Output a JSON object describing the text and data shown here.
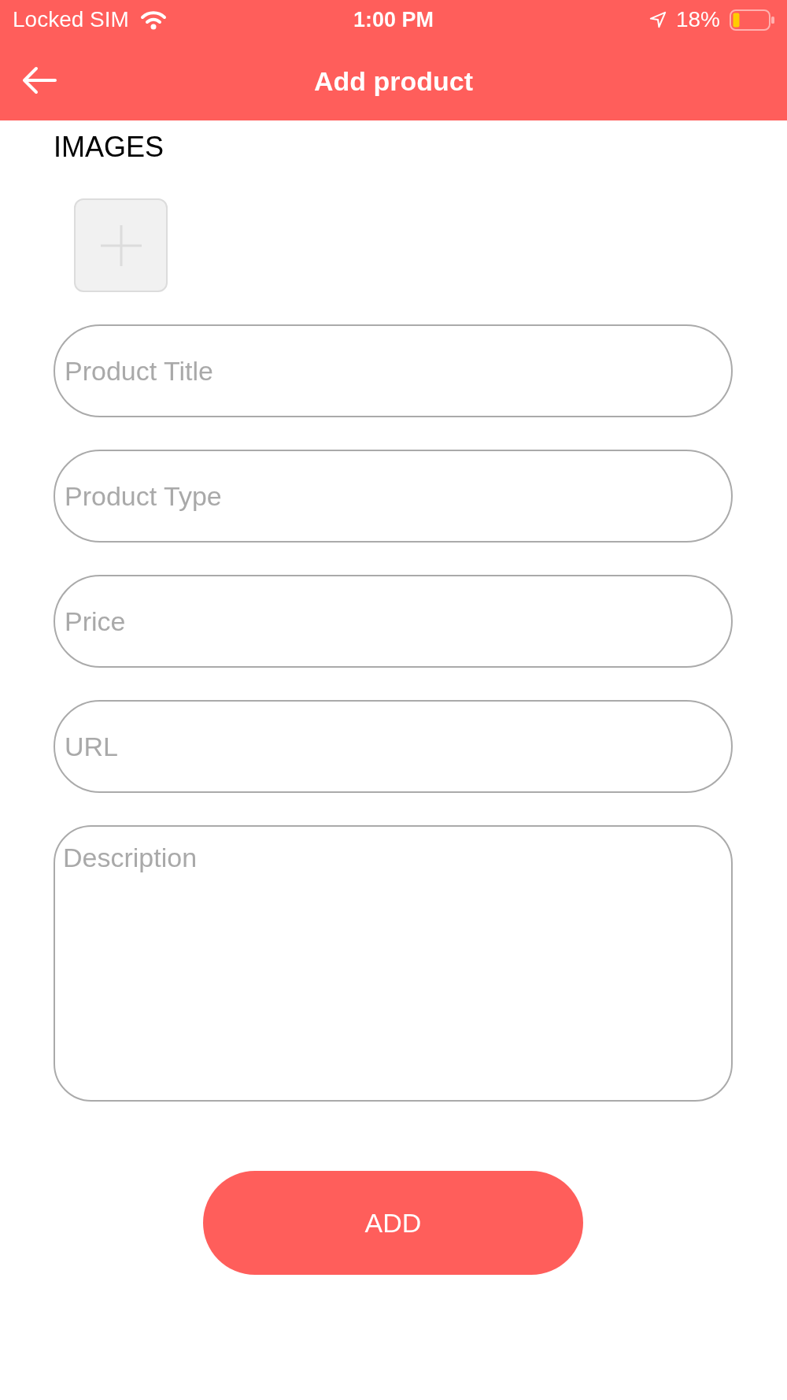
{
  "status_bar": {
    "carrier": "Locked SIM",
    "time": "1:00 PM",
    "battery_percent": "18%"
  },
  "nav_bar": {
    "title": "Add product"
  },
  "images": {
    "label": "IMAGES"
  },
  "fields": [
    {
      "kind": "input",
      "placeholder": "Product Title"
    },
    {
      "kind": "input",
      "placeholder": "Product Type"
    },
    {
      "kind": "input",
      "placeholder": "Price"
    },
    {
      "kind": "input",
      "placeholder": "URL"
    },
    {
      "kind": "textarea",
      "placeholder": "Description"
    }
  ],
  "buttons": [
    "ADD"
  ]
}
